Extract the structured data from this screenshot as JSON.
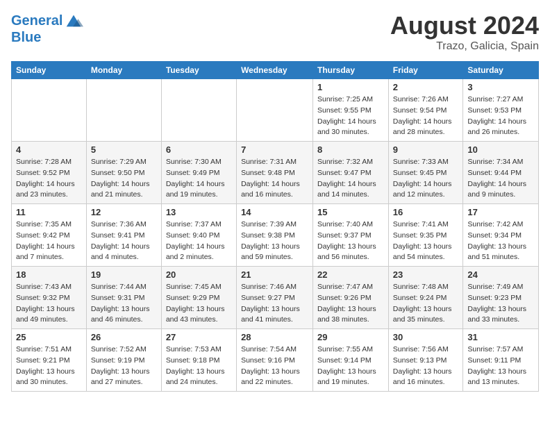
{
  "logo": {
    "line1": "General",
    "line2": "Blue"
  },
  "title": "August 2024",
  "location": "Trazo, Galicia, Spain",
  "days_of_week": [
    "Sunday",
    "Monday",
    "Tuesday",
    "Wednesday",
    "Thursday",
    "Friday",
    "Saturday"
  ],
  "weeks": [
    [
      {
        "day": "",
        "info": ""
      },
      {
        "day": "",
        "info": ""
      },
      {
        "day": "",
        "info": ""
      },
      {
        "day": "",
        "info": ""
      },
      {
        "day": "1",
        "info": "Sunrise: 7:25 AM\nSunset: 9:55 PM\nDaylight: 14 hours\nand 30 minutes."
      },
      {
        "day": "2",
        "info": "Sunrise: 7:26 AM\nSunset: 9:54 PM\nDaylight: 14 hours\nand 28 minutes."
      },
      {
        "day": "3",
        "info": "Sunrise: 7:27 AM\nSunset: 9:53 PM\nDaylight: 14 hours\nand 26 minutes."
      }
    ],
    [
      {
        "day": "4",
        "info": "Sunrise: 7:28 AM\nSunset: 9:52 PM\nDaylight: 14 hours\nand 23 minutes."
      },
      {
        "day": "5",
        "info": "Sunrise: 7:29 AM\nSunset: 9:50 PM\nDaylight: 14 hours\nand 21 minutes."
      },
      {
        "day": "6",
        "info": "Sunrise: 7:30 AM\nSunset: 9:49 PM\nDaylight: 14 hours\nand 19 minutes."
      },
      {
        "day": "7",
        "info": "Sunrise: 7:31 AM\nSunset: 9:48 PM\nDaylight: 14 hours\nand 16 minutes."
      },
      {
        "day": "8",
        "info": "Sunrise: 7:32 AM\nSunset: 9:47 PM\nDaylight: 14 hours\nand 14 minutes."
      },
      {
        "day": "9",
        "info": "Sunrise: 7:33 AM\nSunset: 9:45 PM\nDaylight: 14 hours\nand 12 minutes."
      },
      {
        "day": "10",
        "info": "Sunrise: 7:34 AM\nSunset: 9:44 PM\nDaylight: 14 hours\nand 9 minutes."
      }
    ],
    [
      {
        "day": "11",
        "info": "Sunrise: 7:35 AM\nSunset: 9:42 PM\nDaylight: 14 hours\nand 7 minutes."
      },
      {
        "day": "12",
        "info": "Sunrise: 7:36 AM\nSunset: 9:41 PM\nDaylight: 14 hours\nand 4 minutes."
      },
      {
        "day": "13",
        "info": "Sunrise: 7:37 AM\nSunset: 9:40 PM\nDaylight: 14 hours\nand 2 minutes."
      },
      {
        "day": "14",
        "info": "Sunrise: 7:39 AM\nSunset: 9:38 PM\nDaylight: 13 hours\nand 59 minutes."
      },
      {
        "day": "15",
        "info": "Sunrise: 7:40 AM\nSunset: 9:37 PM\nDaylight: 13 hours\nand 56 minutes."
      },
      {
        "day": "16",
        "info": "Sunrise: 7:41 AM\nSunset: 9:35 PM\nDaylight: 13 hours\nand 54 minutes."
      },
      {
        "day": "17",
        "info": "Sunrise: 7:42 AM\nSunset: 9:34 PM\nDaylight: 13 hours\nand 51 minutes."
      }
    ],
    [
      {
        "day": "18",
        "info": "Sunrise: 7:43 AM\nSunset: 9:32 PM\nDaylight: 13 hours\nand 49 minutes."
      },
      {
        "day": "19",
        "info": "Sunrise: 7:44 AM\nSunset: 9:31 PM\nDaylight: 13 hours\nand 46 minutes."
      },
      {
        "day": "20",
        "info": "Sunrise: 7:45 AM\nSunset: 9:29 PM\nDaylight: 13 hours\nand 43 minutes."
      },
      {
        "day": "21",
        "info": "Sunrise: 7:46 AM\nSunset: 9:27 PM\nDaylight: 13 hours\nand 41 minutes."
      },
      {
        "day": "22",
        "info": "Sunrise: 7:47 AM\nSunset: 9:26 PM\nDaylight: 13 hours\nand 38 minutes."
      },
      {
        "day": "23",
        "info": "Sunrise: 7:48 AM\nSunset: 9:24 PM\nDaylight: 13 hours\nand 35 minutes."
      },
      {
        "day": "24",
        "info": "Sunrise: 7:49 AM\nSunset: 9:23 PM\nDaylight: 13 hours\nand 33 minutes."
      }
    ],
    [
      {
        "day": "25",
        "info": "Sunrise: 7:51 AM\nSunset: 9:21 PM\nDaylight: 13 hours\nand 30 minutes."
      },
      {
        "day": "26",
        "info": "Sunrise: 7:52 AM\nSunset: 9:19 PM\nDaylight: 13 hours\nand 27 minutes."
      },
      {
        "day": "27",
        "info": "Sunrise: 7:53 AM\nSunset: 9:18 PM\nDaylight: 13 hours\nand 24 minutes."
      },
      {
        "day": "28",
        "info": "Sunrise: 7:54 AM\nSunset: 9:16 PM\nDaylight: 13 hours\nand 22 minutes."
      },
      {
        "day": "29",
        "info": "Sunrise: 7:55 AM\nSunset: 9:14 PM\nDaylight: 13 hours\nand 19 minutes."
      },
      {
        "day": "30",
        "info": "Sunrise: 7:56 AM\nSunset: 9:13 PM\nDaylight: 13 hours\nand 16 minutes."
      },
      {
        "day": "31",
        "info": "Sunrise: 7:57 AM\nSunset: 9:11 PM\nDaylight: 13 hours\nand 13 minutes."
      }
    ]
  ]
}
